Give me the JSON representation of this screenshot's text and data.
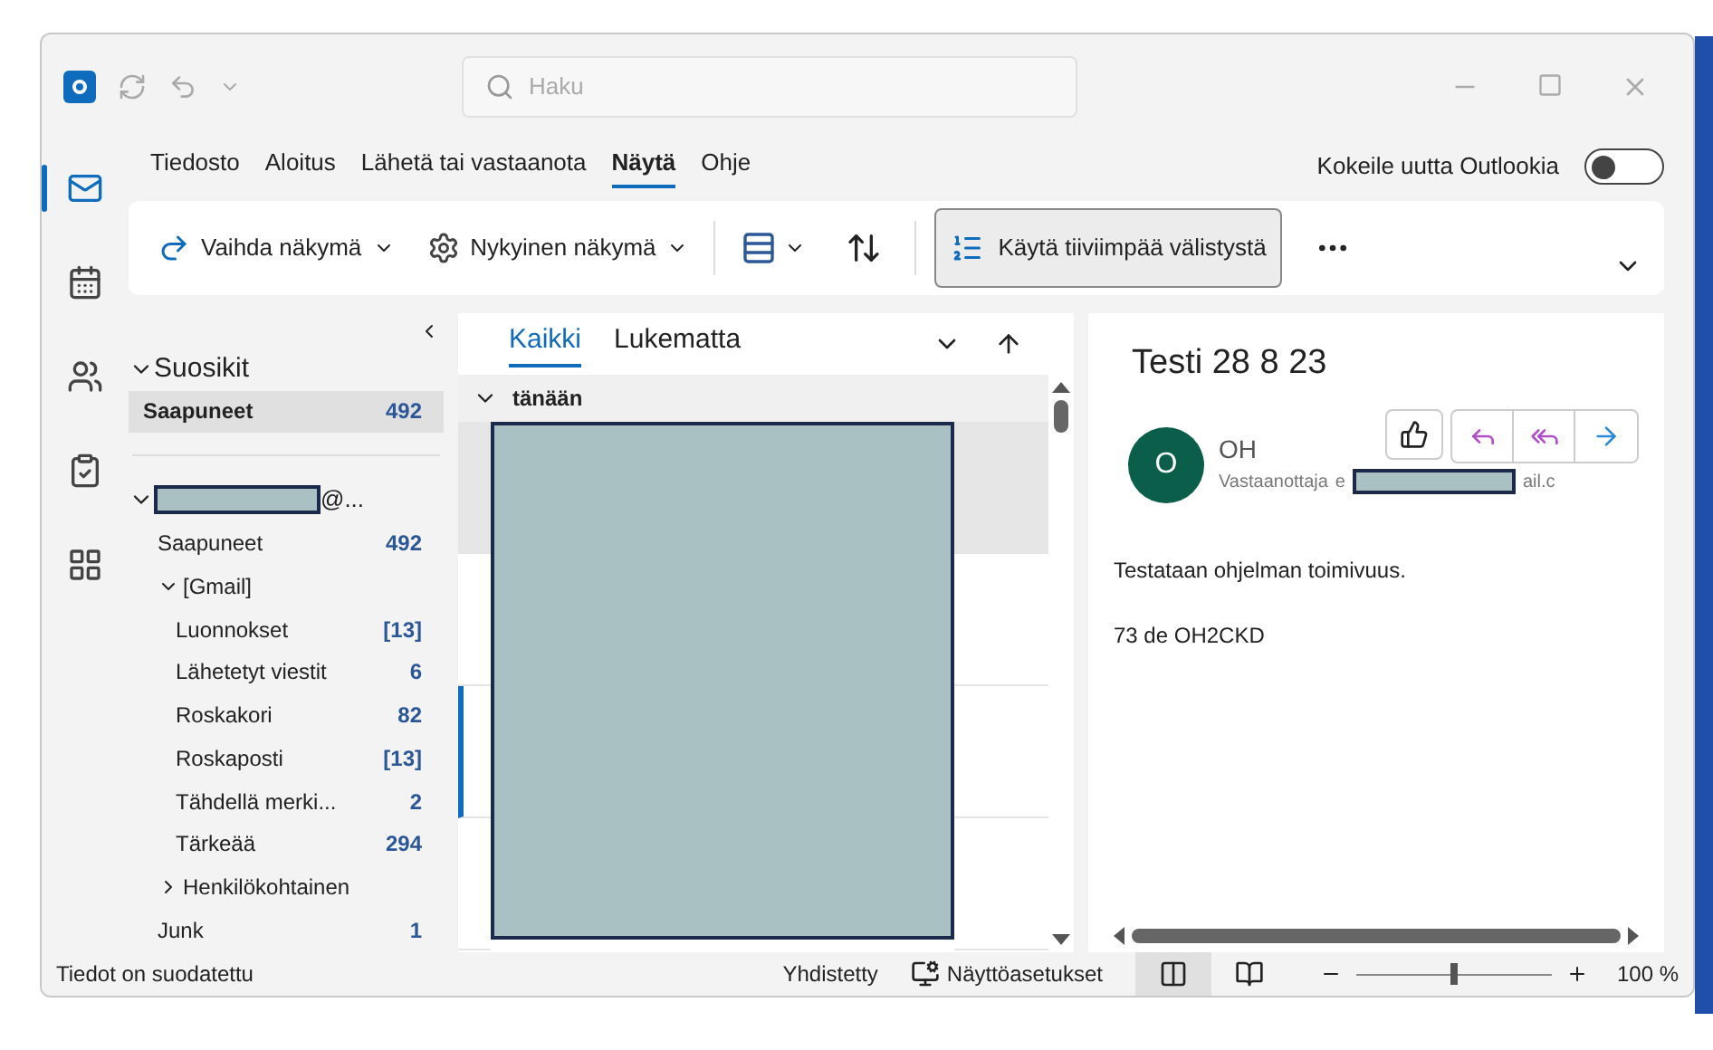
{
  "title_bar": {
    "search_placeholder": "Haku"
  },
  "menu_tabs": [
    {
      "label": "Tiedosto",
      "selected": false
    },
    {
      "label": "Aloitus",
      "selected": false
    },
    {
      "label": "Lähetä tai vastaanota",
      "selected": false
    },
    {
      "label": "Näytä",
      "selected": true
    },
    {
      "label": "Ohje",
      "selected": false
    }
  ],
  "new_outlook_toggle": {
    "label": "Kokeile uutta Outlookia",
    "on": false
  },
  "ribbon": {
    "buttons": [
      {
        "kind": "change-view",
        "label": "Vaihda näkymä"
      },
      {
        "kind": "current-view",
        "label": "Nykyinen näkymä"
      }
    ],
    "compact": {
      "label": "Käytä tiiviimpää välistystä",
      "selected": true
    }
  },
  "rail": [
    {
      "kind": "mail",
      "selected": true
    },
    {
      "kind": "calendar",
      "selected": false
    },
    {
      "kind": "people",
      "selected": false
    },
    {
      "kind": "tasks",
      "selected": false
    },
    {
      "kind": "apps",
      "selected": false
    }
  ],
  "folder_pane": {
    "favorites": {
      "label": "Suosikit",
      "expanded": true,
      "items": [
        {
          "label": "Saapuneet",
          "count": "492",
          "selected": true
        }
      ]
    },
    "account": {
      "label_suffix": "@...",
      "expanded": true,
      "children": [
        {
          "label": "Saapuneet",
          "count": "492",
          "selected": false
        },
        {
          "label": "[Gmail]",
          "expanded": true,
          "selected": false,
          "children": [
            {
              "label": "Luonnokset",
              "count": "[13]",
              "selected": false
            },
            {
              "label": "Lähetetyt viestit",
              "count": "6",
              "selected": false
            },
            {
              "label": "Roskakori",
              "count": "82",
              "selected": false
            },
            {
              "label": "Roskaposti",
              "count": "[13]",
              "selected": false
            },
            {
              "label": "Tähdellä merki...",
              "count": "2",
              "selected": false
            },
            {
              "label": "Tärkeää",
              "count": "294",
              "selected": false
            }
          ]
        },
        {
          "label": "Henkilökohtainen",
          "expanded": false,
          "selected": false
        },
        {
          "label": "Junk",
          "count": "1",
          "selected": false
        }
      ]
    }
  },
  "message_list": {
    "tabs": [
      {
        "label": "Kaikki",
        "selected": true
      },
      {
        "label": "Lukematta",
        "selected": false
      }
    ],
    "group": {
      "label": "tänään",
      "expanded": true
    },
    "messages": [
      {
        "selected": true,
        "unread": false
      },
      {
        "selected": false,
        "unread": false
      },
      {
        "selected": false,
        "unread": true
      },
      {
        "selected": false,
        "unread": false
      }
    ]
  },
  "reading_pane": {
    "subject": "Testi 28 8 23",
    "avatar_initial": "O",
    "sender": "OH",
    "recipient_label": "Vastaanottaja",
    "recipient_prefix": "e",
    "recipient_suffix": "ail.c",
    "body": [
      "Testataan ohjelman toimivuus.",
      "73 de OH2CKD"
    ]
  },
  "status_bar": {
    "left": "Tiedot on suodatettu",
    "connection": "Yhdistetty",
    "display_settings": "Näyttöasetukset",
    "views": [
      {
        "kind": "normal",
        "selected": true
      },
      {
        "kind": "reading",
        "selected": false
      }
    ],
    "zoom": {
      "level": 0.5,
      "reading": "100 %"
    }
  }
}
